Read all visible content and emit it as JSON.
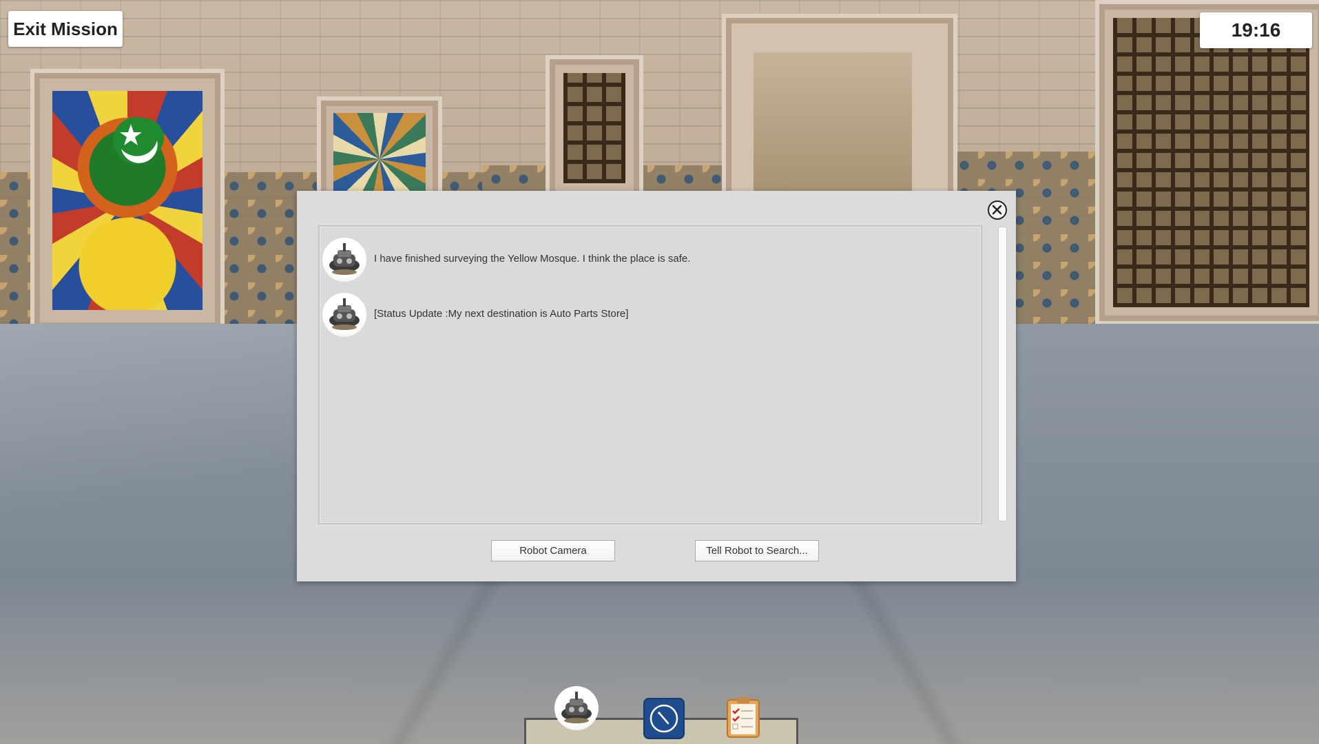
{
  "hud": {
    "exit_label": "Exit Mission",
    "timer": "19:16"
  },
  "dialog": {
    "messages": [
      {
        "text": "I have finished surveying the Yellow Mosque. I think the place is safe."
      },
      {
        "text": "[Status Update :My next destination is Auto Parts Store]"
      }
    ],
    "buttons": {
      "robot_camera": "Robot Camera",
      "tell_robot_search": "Tell Robot to Search..."
    },
    "close_icon": "close-icon"
  },
  "toolbar": {
    "icons": [
      "robot-icon",
      "compass-icon",
      "checklist-icon"
    ]
  },
  "colors": {
    "dialog_bg": "#dcdcdc",
    "hud_bg": "#ffffff",
    "compass_blue": "#1e4c8e"
  }
}
